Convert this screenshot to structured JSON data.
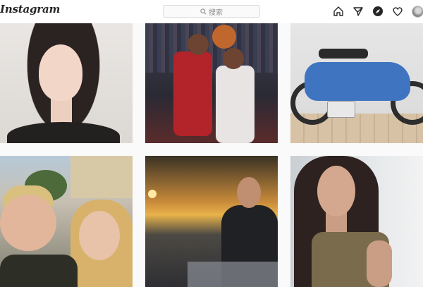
{
  "app": {
    "logo_text": "Instagram"
  },
  "search": {
    "placeholder": "搜索"
  },
  "nav": {
    "icons": [
      "home-icon",
      "direct-message-icon",
      "explore-icon",
      "activity-heart-icon",
      "profile-avatar-icon"
    ]
  },
  "colors": {
    "background": "#fafafa",
    "topbar": "#ffffff",
    "border": "#dbdbdb",
    "text": "#262626",
    "muted": "#8e8e8e"
  },
  "posts": [
    {
      "subject": "portrait-woman-smiling"
    },
    {
      "subject": "basketball-game"
    },
    {
      "subject": "blue-moped"
    },
    {
      "subject": "couple-selfie"
    },
    {
      "subject": "man-at-sunset"
    },
    {
      "subject": "woman-portrait"
    }
  ]
}
